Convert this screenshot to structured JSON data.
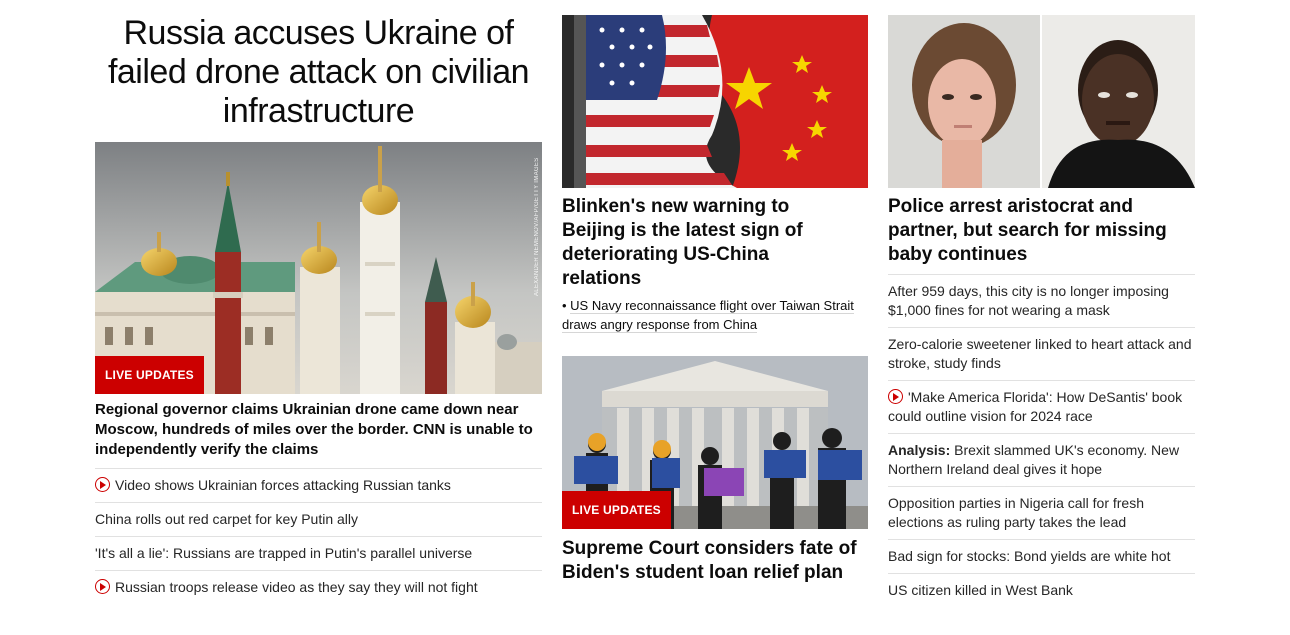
{
  "lead": {
    "headline": "Russia accuses Ukraine of failed drone attack on civilian infrastructure",
    "image_alt": "Kremlin towers and golden domes",
    "credit": "ALEXANDER NEMENOV/AFP/GETTY IMAGES",
    "badge": "LIVE UPDATES",
    "description": "Regional governor claims Ukrainian drone came down near Moscow, hundreds of miles over the border. CNN is unable to independently verify the claims",
    "links": [
      {
        "text": "Video shows Ukrainian forces attacking Russian tanks",
        "video": true
      },
      {
        "text": "China rolls out red carpet for key Putin ally",
        "video": false
      },
      {
        "text": "'It's all a lie': Russians are trapped in Putin's parallel universe",
        "video": false
      },
      {
        "text": "Russian troops release video as they say they will not fight",
        "video": true
      }
    ]
  },
  "middle": {
    "story1": {
      "image_alt": "US and Chinese flags",
      "headline": "Blinken's new warning to Beijing is the latest sign of deteriorating US-China relations",
      "related": "US Navy reconnaissance flight over Taiwan Strait draws angry response from China"
    },
    "story2": {
      "image_alt": "Protesters outside the Supreme Court",
      "badge": "LIVE UPDATES",
      "headline": "Supreme Court considers fate of Biden's student loan relief plan"
    }
  },
  "right": {
    "story": {
      "image_alt": "Police photos of the two suspects",
      "headline": "Police arrest aristocrat and partner, but search for missing baby continues"
    },
    "links": [
      {
        "text": "After 959 days, this city is no longer imposing $1,000 fines for not wearing a mask",
        "video": false,
        "label": ""
      },
      {
        "text": "Zero-calorie sweetener linked to heart attack and stroke, study finds",
        "video": false,
        "label": ""
      },
      {
        "text": "'Make America Florida': How DeSantis' book could outline vision for 2024 race",
        "video": true,
        "label": ""
      },
      {
        "text": "Brexit slammed UK's economy. New Northern Ireland deal gives it hope",
        "video": false,
        "label": "Analysis:"
      },
      {
        "text": "Opposition parties in Nigeria call for fresh elections as ruling party takes the lead",
        "video": false,
        "label": ""
      },
      {
        "text": "Bad sign for stocks: Bond yields are white hot",
        "video": false,
        "label": ""
      },
      {
        "text": "US citizen killed in West Bank",
        "video": false,
        "label": ""
      }
    ]
  },
  "colors": {
    "accent": "#cc0000",
    "text": "#0c0c0c",
    "divider": "#e1e1e1"
  },
  "icons": {
    "video": "play-circle-icon"
  }
}
